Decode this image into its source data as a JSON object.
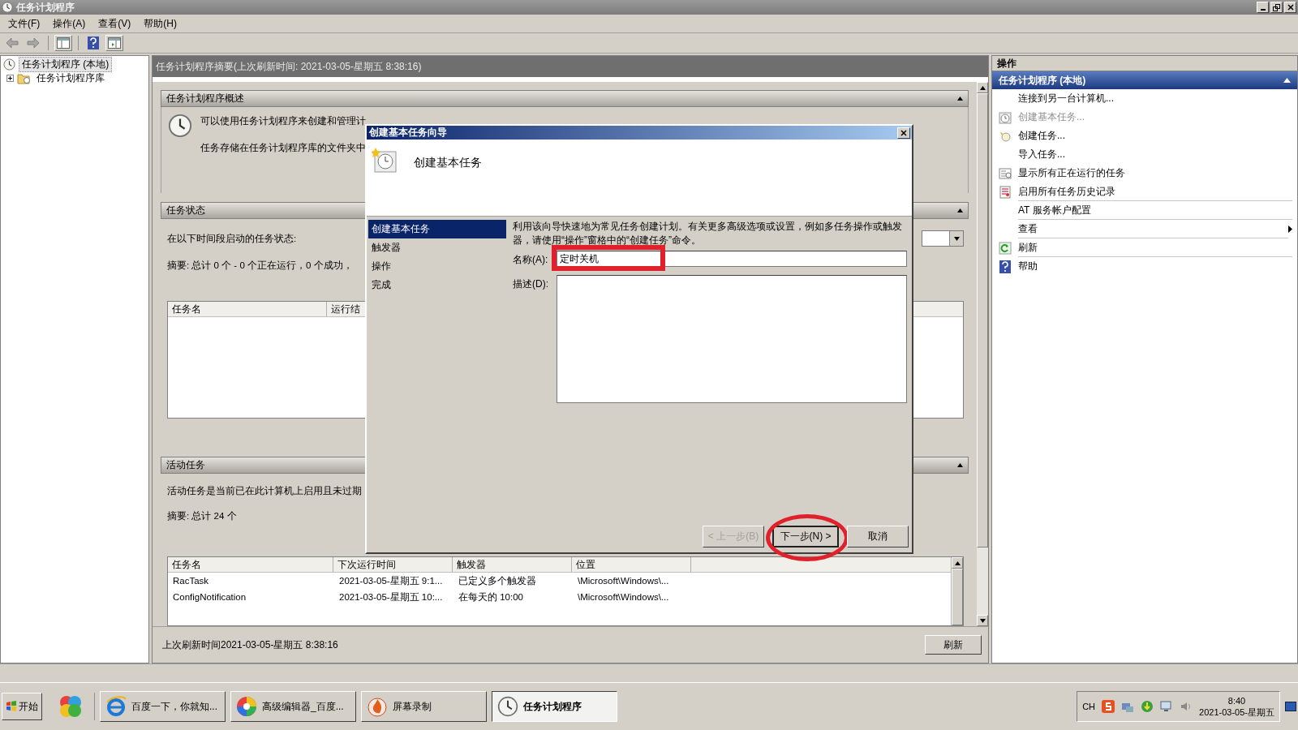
{
  "window": {
    "title": "任务计划程序"
  },
  "menu": [
    "文件(F)",
    "操作(A)",
    "查看(V)",
    "帮助(H)"
  ],
  "tree": [
    {
      "label": "任务计划程序 (本地)",
      "selected": true,
      "children": [
        {
          "label": "任务计划程序库",
          "selected": false,
          "expanded": false
        }
      ]
    }
  ],
  "summary_title": "任务计划程序摘要(上次刷新时间: 2021-03-05-星期五 8:38:16)",
  "overview": {
    "title": "任务计划程序概述",
    "lines": [
      "可以使用任务计划程序来创建和管理计",
      "任务存储在任务计划程序库的文件夹中"
    ]
  },
  "status": {
    "title": "任务状态",
    "period_label": "在以下时间段启动的任务状态:",
    "summary": "摘要: 总计 0 个 - 0 个正在运行，0 个成功，",
    "columns": [
      "任务名",
      "运行结"
    ]
  },
  "active": {
    "title": "活动任务",
    "description": "活动任务是当前已在此计算机上启用且未过期",
    "summary": "摘要: 总计 24 个",
    "columns": [
      "任务名",
      "下次运行时间",
      "触发器",
      "位置"
    ],
    "rows": [
      [
        "RacTask",
        "2021-03-05-星期五 9:1...",
        "已定义多个触发器",
        "\\Microsoft\\Windows\\..."
      ],
      [
        "ConfigNotification",
        "2021-03-05-星期五 10:...",
        "在每天的 10:00",
        "\\Microsoft\\Windows\\..."
      ]
    ]
  },
  "footer": {
    "text": "上次刷新时间2021-03-05-星期五 8:38:16",
    "button": "刷新"
  },
  "dialog": {
    "title": "创建基本任务向导",
    "heading": "创建基本任务",
    "steps": [
      {
        "label": "创建基本任务",
        "selected": true
      },
      {
        "label": "触发器",
        "selected": false
      },
      {
        "label": "操作",
        "selected": false
      },
      {
        "label": "完成",
        "selected": false
      }
    ],
    "intro": "利用该向导快速地为常见任务创建计划。有关更多高级选项或设置，例如多任务操作或触发器，请使用“操作”窗格中的“创建任务”命令。",
    "name_label": "名称(A):",
    "name_value": "定时关机",
    "name_highlighted": true,
    "desc_label": "描述(D):",
    "buttons": [
      {
        "label": "< 上一步(B)",
        "disabled": true,
        "highlighted": false
      },
      {
        "label": "下一步(N) >",
        "disabled": false,
        "highlighted": true
      },
      {
        "label": "取消",
        "disabled": false,
        "highlighted": false
      }
    ]
  },
  "actions": {
    "title": "操作",
    "group": "任务计划程序 (本地)",
    "items": [
      {
        "label": "连接到另一台计算机...",
        "kind": "none",
        "disabled": false,
        "submenu": false,
        "separator": false
      },
      {
        "label": "创建基本任务...",
        "kind": "clock",
        "disabled": true,
        "submenu": false,
        "separator": false
      },
      {
        "label": "创建任务...",
        "kind": "task",
        "disabled": false,
        "submenu": false,
        "separator": false
      },
      {
        "label": "导入任务...",
        "kind": "none",
        "disabled": false,
        "submenu": false,
        "separator": false
      },
      {
        "label": "显示所有正在运行的任务",
        "kind": "list",
        "disabled": false,
        "submenu": false,
        "separator": false
      },
      {
        "label": "启用所有任务历史记录",
        "kind": "history",
        "disabled": false,
        "submenu": false,
        "separator": true
      },
      {
        "label": "AT 服务帐户配置",
        "kind": "none",
        "disabled": false,
        "submenu": false,
        "separator": true
      },
      {
        "label": "查看",
        "kind": "none",
        "disabled": false,
        "submenu": true,
        "separator": true
      },
      {
        "label": "刷新",
        "kind": "refresh",
        "disabled": false,
        "submenu": false,
        "separator": true
      },
      {
        "label": "帮助",
        "kind": "help",
        "disabled": false,
        "submenu": false,
        "separator": false
      }
    ]
  },
  "taskbar": {
    "start": "开始",
    "tasks": [
      {
        "label": "百度一下，你就知...",
        "kind": "browser",
        "selected": false
      },
      {
        "label": "高级编辑器_百度...",
        "kind": "wheel",
        "selected": false
      },
      {
        "label": "屏幕录制",
        "kind": "flame",
        "selected": false
      },
      {
        "label": "任务计划程序",
        "kind": "clock",
        "selected": true
      }
    ],
    "lang": "CH",
    "time": "8:40",
    "date": "2021-03-05-星期五"
  }
}
